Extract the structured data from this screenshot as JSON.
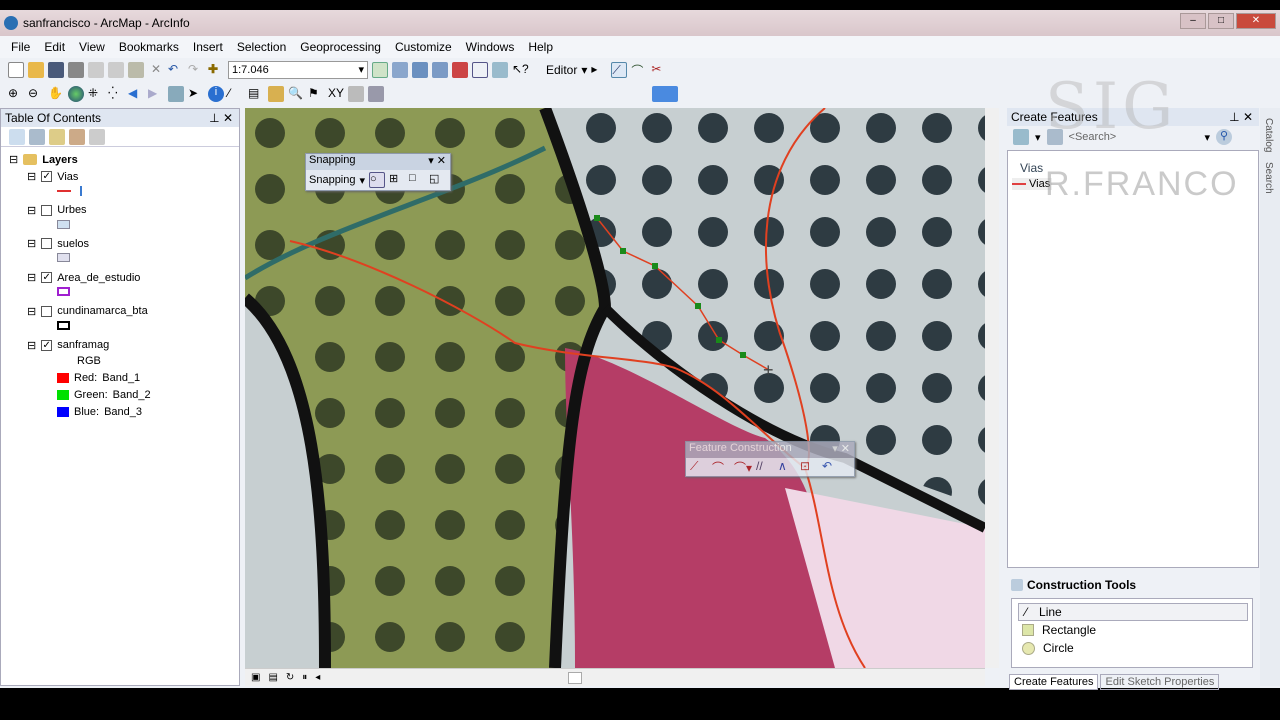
{
  "window": {
    "title": "sanfrancisco - ArcMap - ArcInfo"
  },
  "menu": [
    "File",
    "Edit",
    "View",
    "Bookmarks",
    "Insert",
    "Selection",
    "Geoprocessing",
    "Customize",
    "Windows",
    "Help"
  ],
  "toolbar": {
    "scale": "1:7.046",
    "editor_label": "Editor"
  },
  "toc": {
    "title": "Table Of Contents",
    "root": "Layers",
    "layers": [
      {
        "name": "Vias",
        "checked": true,
        "symbol": "line",
        "color": "#e03030"
      },
      {
        "name": "Urbes",
        "checked": false,
        "symbol": "fill",
        "color": "#cfe0f0"
      },
      {
        "name": "suelos",
        "checked": false,
        "symbol": "fill",
        "color": "#e0e0ee"
      },
      {
        "name": "Area_de_estudio",
        "checked": true,
        "symbol": "outline",
        "color": "#a020d0"
      },
      {
        "name": "cundinamarca_bta",
        "checked": false,
        "symbol": "outline",
        "color": "#000000"
      },
      {
        "name": "sanframag",
        "checked": true,
        "symbol": "raster",
        "color": ""
      }
    ],
    "rgb_label": "RGB",
    "bands": [
      {
        "channel": "Red:",
        "band": "Band_1",
        "color": "#ff0000"
      },
      {
        "channel": "Green:",
        "band": "Band_2",
        "color": "#00e000"
      },
      {
        "channel": "Blue:",
        "band": "Band_3",
        "color": "#0000ff"
      }
    ]
  },
  "snapping": {
    "title": "Snapping",
    "menu": "Snapping"
  },
  "feature_construction": {
    "title": "Feature Construction"
  },
  "create_features": {
    "title": "Create Features",
    "search_placeholder": "<Search>",
    "group": "Vias",
    "template": "Vias"
  },
  "construction_tools": {
    "title": "Construction Tools",
    "items": [
      "Line",
      "Rectangle",
      "Circle"
    ]
  },
  "bottom_tabs": [
    "Create Features",
    "Edit Sketch Properties"
  ],
  "side_tabs": [
    "Catalog",
    "Search"
  ],
  "watermark": {
    "line1": "SIG",
    "line2": "R.FRANCO"
  }
}
